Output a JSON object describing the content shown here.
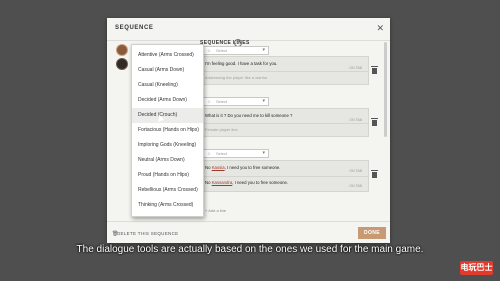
{
  "modal": {
    "title": "SEQUENCE",
    "close_glyph": "✕",
    "section_label": "SEQUENCE LINES",
    "help_glyph": "?",
    "select_placeholder": "Select",
    "lines": [
      {
        "text": "I'm feeling good. I have a task for you.",
        "meta": "ON TAB",
        "placeholder": "Addressing the player like a warrior"
      },
      {
        "text": "What is it ? Do you need me to kill someone ?",
        "meta": "ON TAB",
        "placeholder": "Female player line"
      },
      {
        "text_pre": "No ",
        "text_link": "Kassia",
        "text_post": ", I need you to free someone.",
        "meta": "ON TAB"
      },
      {
        "text_pre": "No ",
        "text_link": "Kassandra",
        "text_post": ", I need you to free someone.",
        "meta": "ON TAB"
      }
    ],
    "add_line_label": "+ Add a line",
    "delete_label": "DELETE THIS SEQUENCE",
    "done_label": "DONE"
  },
  "dropdown": {
    "items": [
      "Attentive (Arms Crossed)",
      "Casual (Arms Down)",
      "Casual (Kneeling)",
      "Decided (Arms Down)",
      "Decided (Crouch)",
      "Fortacious (Hands on Hips)",
      "Imploring Gods (Kneeling)",
      "Neutral (Arms Down)",
      "Proud (Hands on Hips)",
      "Rebellious (Arms Crossed)",
      "Thinking (Arms Crossed)"
    ],
    "active_index": 4
  },
  "subtitle": "The dialogue tools are actually based on the ones we used for the main game.",
  "watermark": "电玩巴士",
  "icons": {
    "trash": "trash-icon",
    "delete": "trash-icon",
    "help": "help-icon",
    "close": "close-icon",
    "emote": "emote-icon"
  }
}
